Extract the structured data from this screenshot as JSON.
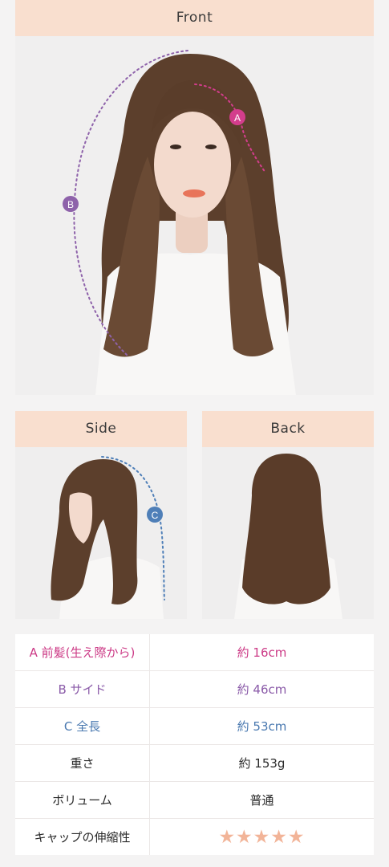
{
  "front": {
    "header": "Front",
    "marker_a": "A",
    "marker_b": "B"
  },
  "side": {
    "header": "Side",
    "marker_c": "C"
  },
  "back": {
    "header": "Back"
  },
  "colors": {
    "header_bg": "#f9dfcf",
    "marker_a": "#d33d8c",
    "marker_b": "#8e62aa",
    "marker_c": "#4f7fb8",
    "stars": "#f2b498"
  },
  "specs": {
    "rows": [
      {
        "label": "A 前髪(生え際から)",
        "value": "約 16cm"
      },
      {
        "label": "B サイド",
        "value": "約 46cm"
      },
      {
        "label": "C 全長",
        "value": "約 53cm"
      },
      {
        "label": "重さ",
        "value": "約 153g"
      },
      {
        "label": "ボリューム",
        "value": "普通"
      },
      {
        "label": "キャップの伸縮性",
        "value": "★★★★★",
        "rating": 5,
        "rating_max": 5
      }
    ]
  }
}
